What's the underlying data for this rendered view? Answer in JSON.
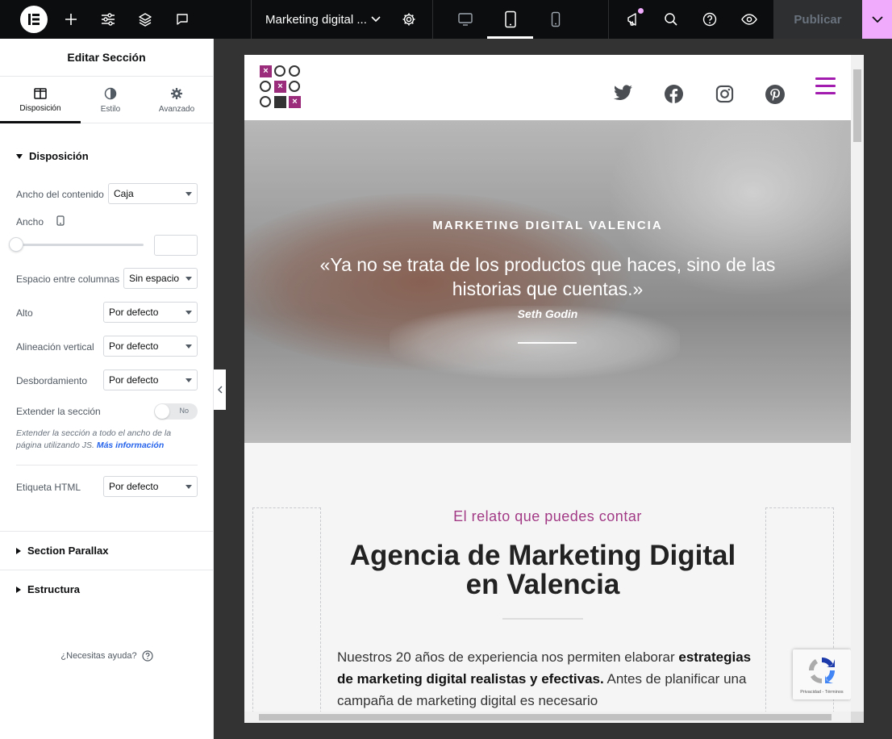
{
  "topbar": {
    "page_title": "Marketing digital ...",
    "publish_label": "Publicar",
    "icons": [
      "elementor-logo-icon",
      "add-icon",
      "sliders-icon",
      "layers-icon",
      "comment-icon",
      "chevron-down-icon",
      "gear-icon",
      "desktop-icon",
      "tablet-icon",
      "mobile-icon",
      "megaphone-icon",
      "search-icon",
      "help-icon",
      "eye-icon",
      "chevron-down-icon"
    ],
    "accent": "#f0abfc"
  },
  "panel": {
    "title": "Editar Sección",
    "tabs": [
      {
        "label": "Disposición",
        "icon": "columns-icon",
        "active": true
      },
      {
        "label": "Estilo",
        "icon": "half-circle-icon",
        "active": false
      },
      {
        "label": "Avanzado",
        "icon": "gear-icon",
        "active": false
      }
    ],
    "section_layout": "Disposición",
    "controls": {
      "content_width_label": "Ancho del contenido",
      "content_width_value": "Caja",
      "width_label": "Ancho",
      "column_gap_label": "Espacio entre columnas",
      "column_gap_value": "Sin espacio",
      "height_label": "Alto",
      "height_value": "Por defecto",
      "valign_label": "Alineación vertical",
      "valign_value": "Por defecto",
      "overflow_label": "Desbordamiento",
      "overflow_value": "Por defecto",
      "stretch_label": "Extender la sección",
      "stretch_value": "No",
      "stretch_help": "Extender la sección a todo el ancho de la página utilizando JS.",
      "stretch_help_link": "Más información",
      "html_tag_label": "Etiqueta HTML",
      "html_tag_value": "Por defecto"
    },
    "section_parallax": "Section Parallax",
    "section_structure": "Estructura",
    "need_help": "¿Necesitas ayuda?"
  },
  "preview": {
    "social_icons": [
      "twitter-icon",
      "facebook-icon",
      "instagram-icon",
      "pinterest-icon"
    ],
    "brand_color": "#a21caf",
    "hero": {
      "kicker": "MARKETING DIGITAL VALENCIA",
      "quote": "«Ya no se trata de los productos que haces, sino de las historias que cuentas.»",
      "author": "Seth Godin"
    },
    "subtitle": "El relato que puedes contar",
    "heading": "Agencia de Marketing Digital en Valencia",
    "body_start": "Nuestros 20 años de experiencia nos permiten elaborar ",
    "body_bold": "estrategias de marketing digital realistas y efectivas.",
    "body_end": " Antes de planificar una campaña de marketing digital es necesario",
    "recaptcha_label": "Privacidad - Términos"
  }
}
